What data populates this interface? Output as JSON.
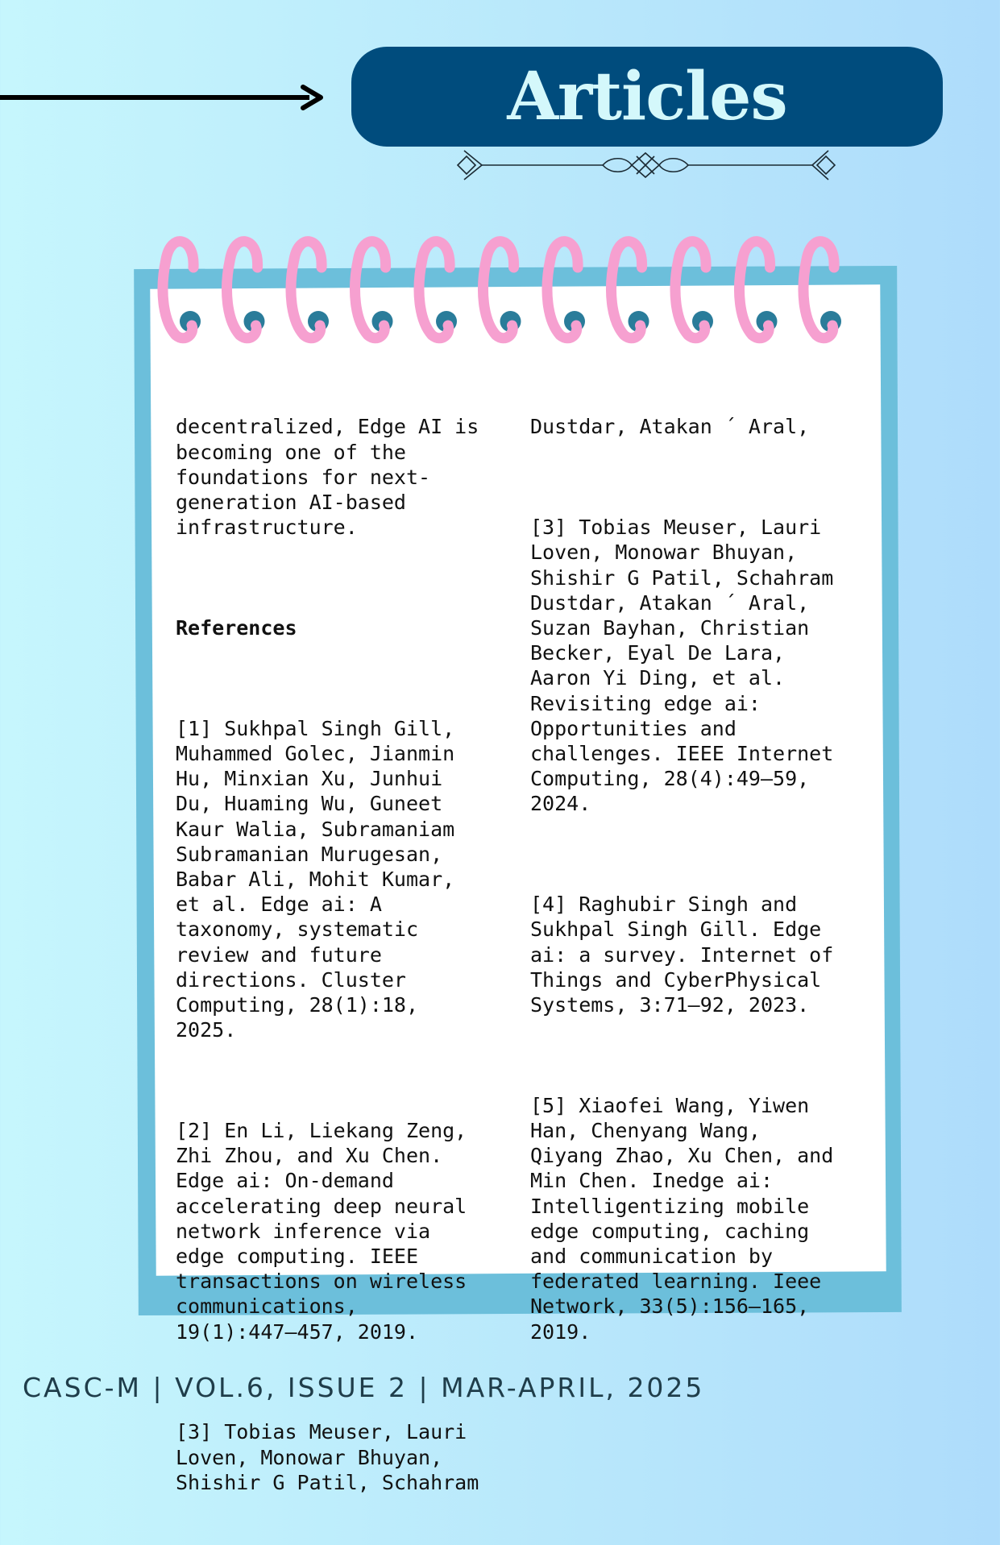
{
  "header": {
    "title": "Articles"
  },
  "left_column": {
    "paragraphs": [
      {
        "text": "decentralized, Edge AI is\nbecoming one of the\nfoundations for next-\ngeneration AI-based\ninfrastructure."
      },
      {
        "text": "References"
      },
      {
        "text": "[1] Sukhpal Singh Gill,\nMuhammed Golec, Jianmin\nHu, Minxian Xu, Junhui\nDu, Huaming Wu, Guneet\nKaur Walia, Subramaniam\nSubramanian Murugesan,\nBabar Ali, Mohit Kumar,\net al. Edge ai: A\ntaxonomy, systematic\nreview and future\ndirections. Cluster\nComputing, 28(1):18,\n2025."
      },
      {
        "text": "[2] En Li, Liekang Zeng,\nZhi Zhou, and Xu Chen.\nEdge ai: On-demand\naccelerating deep neural\nnetwork inference via\nedge computing. IEEE\ntransactions on wireless\ncommunications,\n19(1):447–457, 2019."
      },
      {
        "text": "[3] Tobias Meuser, Lauri\nLoven, Monowar Bhuyan,\nShishir G Patil, Schahram"
      }
    ]
  },
  "right_column": {
    "paragraphs": [
      {
        "text": "Dustdar, Atakan ´ Aral,"
      },
      {
        "text": "[3] Tobias Meuser, Lauri\nLoven, Monowar Bhuyan,\nShishir G Patil, Schahram\nDustdar, Atakan ´ Aral,\nSuzan Bayhan, Christian\nBecker, Eyal De Lara,\nAaron Yi Ding, et al.\nRevisiting edge ai:\nOpportunities and\nchallenges. IEEE Internet\nComputing, 28(4):49–59,\n2024."
      },
      {
        "text": "[4] Raghubir Singh and\nSukhpal Singh Gill. Edge\nai: a survey. Internet of\nThings and CyberPhysical\nSystems, 3:71–92, 2023."
      },
      {
        "text": "[5] Xiaofei Wang, Yiwen\nHan, Chenyang Wang,\nQiyang Zhao, Xu Chen, and\nMin Chen. Inedge ai:\nIntelligentizing mobile\nedge computing, caching\nand communication by\nfederated learning. Ieee\nNetwork, 33(5):156–165,\n2019."
      }
    ]
  },
  "footer": {
    "text": "CASC-M | VOL.6, ISSUE 2 | MAR-APRIL, 2025"
  },
  "colors": {
    "title_pill": "#004c7d",
    "title_text": "#d4f8fb",
    "notebook_back": "#6cbfdb",
    "spiral_ring": "#f6a0d0",
    "spiral_hole": "#2a7c9a"
  },
  "icons": {
    "arrow": "right-arrow-icon",
    "ornament": "divider-ornament-icon",
    "spiral": "spiral-binding-icon"
  }
}
